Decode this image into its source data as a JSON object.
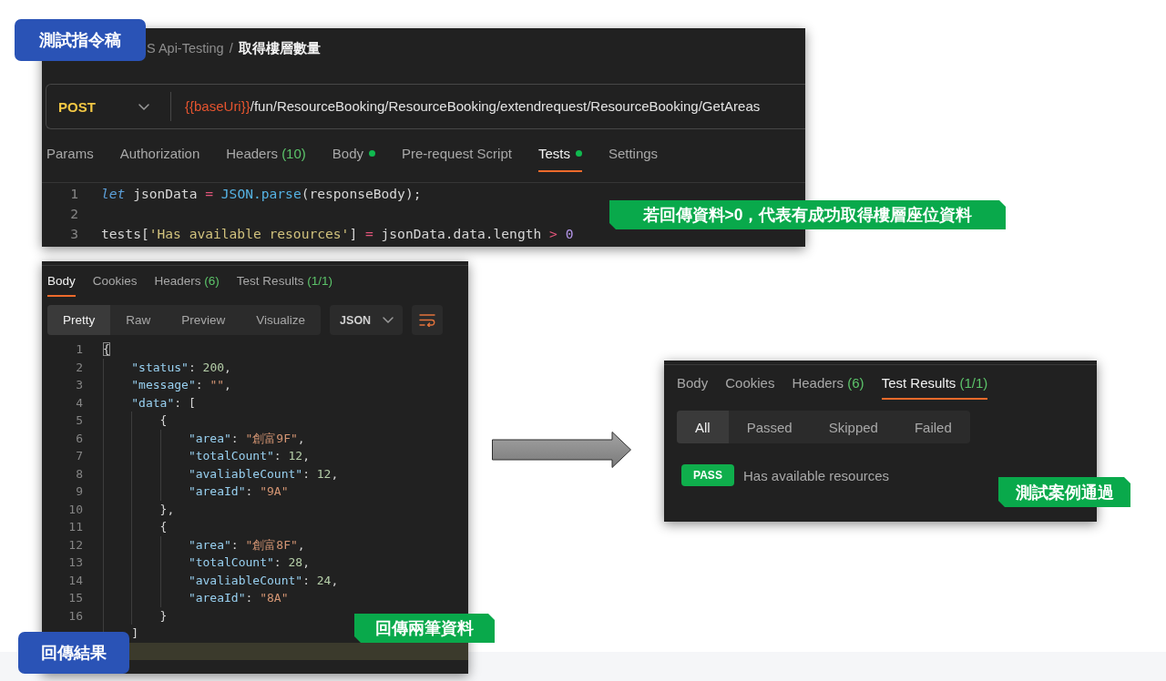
{
  "request_panel": {
    "title_label": "測試指令稿",
    "breadcrumb": {
      "collection": "S Api-Testing",
      "separator": "/",
      "request": "取得樓層數量"
    },
    "method": "POST",
    "url": [
      {
        "text": "{{baseUri}}",
        "kind": "variable"
      },
      {
        "text": "/fun/ResourceBooking/ResourceBooking/extendrequest/ResourceBooking/GetAreas",
        "kind": "path"
      }
    ],
    "tabs": [
      {
        "label": "Params",
        "selected": false,
        "dot": false
      },
      {
        "label": "Authorization",
        "selected": false,
        "dot": false
      },
      {
        "label": "Headers",
        "count": "(10)",
        "selected": false,
        "dot": false
      },
      {
        "label": "Body",
        "selected": false,
        "dot": true
      },
      {
        "label": "Pre-request Script",
        "selected": false,
        "dot": false
      },
      {
        "label": "Tests",
        "selected": true,
        "dot": true
      },
      {
        "label": "Settings",
        "selected": false,
        "dot": false
      }
    ],
    "code": [
      {
        "number": "1",
        "tokens": [
          {
            "text": "let",
            "kind": "keyword"
          },
          {
            "text": " jsonData ",
            "kind": "plain"
          },
          {
            "text": "=",
            "kind": "operator"
          },
          {
            "text": " JSON.parse",
            "kind": "function"
          },
          {
            "text": "(responseBody);",
            "kind": "plain"
          }
        ]
      },
      {
        "number": "2"
      },
      {
        "number": "3",
        "tokens": [
          {
            "text": "tests[",
            "kind": "plain"
          },
          {
            "text": "'Has available resources'",
            "kind": "string"
          },
          {
            "text": "] ",
            "kind": "plain"
          },
          {
            "text": "=",
            "kind": "operator"
          },
          {
            "text": " jsonData.data.length ",
            "kind": "plain"
          },
          {
            "text": ">",
            "kind": "operator"
          },
          {
            "text": " 0",
            "kind": "number"
          }
        ]
      }
    ],
    "note": "若回傳資料>0，代表有成功取得樓層座位資料"
  },
  "response_panel": {
    "tabs": [
      {
        "label": "Body",
        "selected": true
      },
      {
        "label": "Cookies",
        "selected": false
      },
      {
        "label": "Headers",
        "count": "(6)",
        "selected": false
      },
      {
        "label": "Test Results",
        "count": "(1/1)",
        "selected": false
      }
    ],
    "views": [
      {
        "label": "Pretty",
        "selected": true
      },
      {
        "label": "Raw",
        "selected": false
      },
      {
        "label": "Preview",
        "selected": false
      },
      {
        "label": "Visualize",
        "selected": false
      }
    ],
    "format": "JSON",
    "code": [
      {
        "number": "1",
        "highlighted": false,
        "tokens": [
          {
            "text": "{",
            "kind": "bracket-match"
          }
        ]
      },
      {
        "number": "2",
        "highlighted": false,
        "tokens": [
          {
            "text": "    \"status\"",
            "kind": "key"
          },
          {
            "text": ": ",
            "kind": "plain"
          },
          {
            "text": "200",
            "kind": "number"
          },
          {
            "text": ",",
            "kind": "plain"
          }
        ]
      },
      {
        "number": "3",
        "highlighted": false,
        "tokens": [
          {
            "text": "    \"message\"",
            "kind": "key"
          },
          {
            "text": ": ",
            "kind": "plain"
          },
          {
            "text": "\"\"",
            "kind": "string"
          },
          {
            "text": ",",
            "kind": "plain"
          }
        ]
      },
      {
        "number": "4",
        "highlighted": false,
        "tokens": [
          {
            "text": "    \"data\"",
            "kind": "key"
          },
          {
            "text": ": [",
            "kind": "plain"
          }
        ]
      },
      {
        "number": "5",
        "highlighted": false,
        "tokens": [
          {
            "text": "        {",
            "kind": "plain"
          }
        ]
      },
      {
        "number": "6",
        "highlighted": false,
        "tokens": [
          {
            "text": "            \"area\"",
            "kind": "key"
          },
          {
            "text": ": ",
            "kind": "plain"
          },
          {
            "text": "\"創富9F\"",
            "kind": "string"
          },
          {
            "text": ",",
            "kind": "plain"
          }
        ]
      },
      {
        "number": "7",
        "highlighted": false,
        "tokens": [
          {
            "text": "            \"totalCount\"",
            "kind": "key"
          },
          {
            "text": ": ",
            "kind": "plain"
          },
          {
            "text": "12",
            "kind": "number"
          },
          {
            "text": ",",
            "kind": "plain"
          }
        ]
      },
      {
        "number": "8",
        "highlighted": false,
        "tokens": [
          {
            "text": "            \"avaliableCount\"",
            "kind": "key"
          },
          {
            "text": ": ",
            "kind": "plain"
          },
          {
            "text": "12",
            "kind": "number"
          },
          {
            "text": ",",
            "kind": "plain"
          }
        ]
      },
      {
        "number": "9",
        "highlighted": false,
        "tokens": [
          {
            "text": "            \"areaId\"",
            "kind": "key"
          },
          {
            "text": ": ",
            "kind": "plain"
          },
          {
            "text": "\"9A\"",
            "kind": "string"
          }
        ]
      },
      {
        "number": "10",
        "highlighted": false,
        "tokens": [
          {
            "text": "        },",
            "kind": "plain"
          }
        ]
      },
      {
        "number": "11",
        "highlighted": false,
        "tokens": [
          {
            "text": "        {",
            "kind": "plain"
          }
        ]
      },
      {
        "number": "12",
        "highlighted": false,
        "tokens": [
          {
            "text": "            \"area\"",
            "kind": "key"
          },
          {
            "text": ": ",
            "kind": "plain"
          },
          {
            "text": "\"創富8F\"",
            "kind": "string"
          },
          {
            "text": ",",
            "kind": "plain"
          }
        ]
      },
      {
        "number": "13",
        "highlighted": false,
        "tokens": [
          {
            "text": "            \"totalCount\"",
            "kind": "key"
          },
          {
            "text": ": ",
            "kind": "plain"
          },
          {
            "text": "28",
            "kind": "number"
          },
          {
            "text": ",",
            "kind": "plain"
          }
        ]
      },
      {
        "number": "14",
        "highlighted": false,
        "tokens": [
          {
            "text": "            \"avaliableCount\"",
            "kind": "key"
          },
          {
            "text": ": ",
            "kind": "plain"
          },
          {
            "text": "24",
            "kind": "number"
          },
          {
            "text": ",",
            "kind": "plain"
          }
        ]
      },
      {
        "number": "15",
        "highlighted": false,
        "tokens": [
          {
            "text": "            \"areaId\"",
            "kind": "key"
          },
          {
            "text": ": ",
            "kind": "plain"
          },
          {
            "text": "\"8A\"",
            "kind": "string"
          }
        ]
      },
      {
        "number": "16",
        "highlighted": false,
        "tokens": [
          {
            "text": "        }",
            "kind": "plain"
          }
        ]
      },
      {
        "highlighted": false,
        "tokens": [
          {
            "text": "    ]",
            "kind": "plain"
          }
        ]
      },
      {
        "highlighted": true
      }
    ],
    "note": "回傳兩筆資料",
    "title_label": "回傳結果"
  },
  "test_results_panel": {
    "tabs": [
      {
        "label": "Body",
        "selected": false
      },
      {
        "label": "Cookies",
        "selected": false
      },
      {
        "label": "Headers",
        "count": "(6)",
        "selected": false
      },
      {
        "label": "Test Results",
        "count": "(1/1)",
        "selected": true
      }
    ],
    "filters": [
      {
        "label": "All",
        "selected": true
      },
      {
        "label": "Passed",
        "selected": false
      },
      {
        "label": "Skipped",
        "selected": false
      },
      {
        "label": "Failed",
        "selected": false
      }
    ],
    "results": [
      {
        "status": "PASS",
        "kind": "pass",
        "name": "Has available resources"
      }
    ],
    "note": "測試案例通過"
  }
}
